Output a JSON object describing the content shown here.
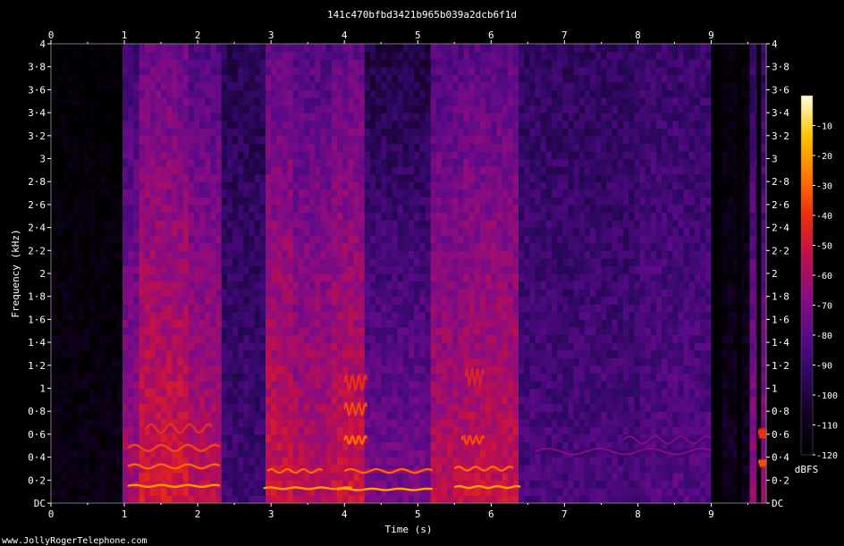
{
  "page": {
    "title": "141c470bfbd3421b965b039a2dcb6f1d",
    "footer": "www.JollyRogerTelephone.com"
  },
  "chart_data": {
    "type": "heatmap",
    "title": "141c470bfbd3421b965b039a2dcb6f1d",
    "xlabel": "Time (s)",
    "ylabel": "Frequency (kHz)",
    "xlim": [
      0,
      9.75
    ],
    "ylim": [
      0,
      4
    ],
    "x_ticks": [
      "0",
      "1",
      "2",
      "3",
      "4",
      "5",
      "6",
      "7",
      "8",
      "9"
    ],
    "x_tick_values": [
      0,
      1,
      2,
      3,
      4,
      5,
      6,
      7,
      8,
      9
    ],
    "y_ticks": [
      "DC",
      "0·2",
      "0·4",
      "0·6",
      "0·8",
      "1",
      "1·2",
      "1·4",
      "1·6",
      "1·8",
      "2",
      "2·2",
      "2·4",
      "2·6",
      "2·8",
      "3",
      "3·2",
      "3·4",
      "3·6",
      "3·8",
      "4"
    ],
    "y_tick_values": [
      0,
      0.2,
      0.4,
      0.6,
      0.8,
      1,
      1.2,
      1.4,
      1.6,
      1.8,
      2,
      2.2,
      2.4,
      2.6,
      2.8,
      3,
      3.2,
      3.4,
      3.6,
      3.8,
      4
    ],
    "colorbar": {
      "label": "dBFS",
      "ticks": [
        "-10",
        "-20",
        "-30",
        "-40",
        "-50",
        "-60",
        "-70",
        "-80",
        "-90",
        "-100",
        "-110",
        "-120"
      ],
      "tick_values": [
        -10,
        -20,
        -30,
        -40,
        -50,
        -60,
        -70,
        -80,
        -90,
        -100,
        -110,
        -120
      ],
      "range": [
        0,
        -120
      ]
    },
    "segments": [
      {
        "start": 0.0,
        "end": 1.0,
        "level": -112
      },
      {
        "start": 1.0,
        "end": 1.2,
        "level": -60
      },
      {
        "start": 1.2,
        "end": 1.9,
        "level": -48
      },
      {
        "start": 1.9,
        "end": 2.35,
        "level": -55
      },
      {
        "start": 2.35,
        "end": 2.95,
        "level": -88
      },
      {
        "start": 2.95,
        "end": 3.3,
        "level": -50
      },
      {
        "start": 3.3,
        "end": 3.8,
        "level": -55
      },
      {
        "start": 3.8,
        "end": 4.3,
        "level": -50
      },
      {
        "start": 4.3,
        "end": 5.2,
        "level": -72
      },
      {
        "start": 5.2,
        "end": 5.6,
        "level": -55
      },
      {
        "start": 5.6,
        "end": 6.4,
        "level": -52
      },
      {
        "start": 6.4,
        "end": 8.0,
        "level": -85
      },
      {
        "start": 8.0,
        "end": 9.0,
        "level": -82
      },
      {
        "start": 9.0,
        "end": 9.55,
        "level": -108
      },
      {
        "start": 9.55,
        "end": 9.75,
        "level": -65
      }
    ],
    "silent_bands": [
      {
        "start": 9.0,
        "end": 9.15
      },
      {
        "start": 9.35,
        "end": 9.42
      },
      {
        "start": 9.62,
        "end": 9.68
      }
    ],
    "harmonic_tracks": [
      {
        "t0": 1.05,
        "t1": 2.3,
        "f": 0.15,
        "level": -20
      },
      {
        "t0": 1.05,
        "t1": 2.3,
        "f": 0.32,
        "level": -30
      },
      {
        "t0": 1.05,
        "t1": 2.3,
        "f": 0.48,
        "level": -35
      },
      {
        "t0": 1.3,
        "t1": 2.2,
        "f": 0.65,
        "level": -40
      },
      {
        "t0": 2.9,
        "t1": 4.1,
        "f": 0.13,
        "level": -20
      },
      {
        "t0": 2.95,
        "t1": 3.7,
        "f": 0.28,
        "level": -30
      },
      {
        "t0": 3.9,
        "t1": 5.2,
        "f": 0.12,
        "level": -18
      },
      {
        "t0": 4.0,
        "t1": 5.2,
        "f": 0.28,
        "level": -30
      },
      {
        "t0": 4.0,
        "t1": 4.3,
        "f": 0.55,
        "level": -30
      },
      {
        "t0": 4.0,
        "t1": 4.3,
        "f": 0.82,
        "level": -35
      },
      {
        "t0": 4.0,
        "t1": 4.3,
        "f": 1.05,
        "level": -40
      },
      {
        "t0": 5.5,
        "t1": 6.4,
        "f": 0.14,
        "level": -20
      },
      {
        "t0": 5.5,
        "t1": 6.3,
        "f": 0.3,
        "level": -30
      },
      {
        "t0": 5.6,
        "t1": 5.9,
        "f": 0.55,
        "level": -35
      },
      {
        "t0": 5.65,
        "t1": 5.9,
        "f": 1.1,
        "level": -45
      },
      {
        "t0": 6.6,
        "t1": 9.0,
        "f": 0.45,
        "level": -70
      },
      {
        "t0": 7.8,
        "t1": 9.0,
        "f": 0.55,
        "level": -70
      },
      {
        "t0": 9.65,
        "t1": 9.75,
        "f": 0.35,
        "level": -35
      },
      {
        "t0": 9.65,
        "t1": 9.75,
        "f": 0.6,
        "level": -40
      }
    ],
    "colormap": [
      "#000000",
      "#120020",
      "#2c0860",
      "#5a0a88",
      "#8c0c80",
      "#c0104a",
      "#ee2c10",
      "#ff7a00",
      "#ffc400",
      "#ffffd8"
    ]
  }
}
